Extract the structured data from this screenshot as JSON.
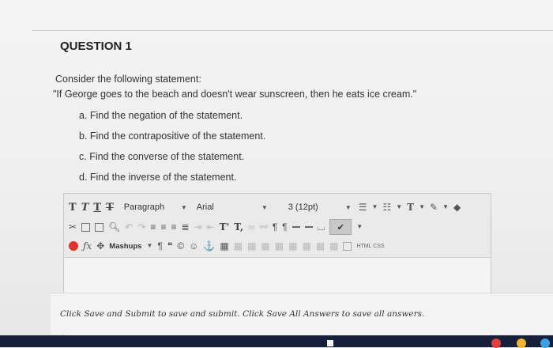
{
  "question": {
    "title": "QUESTION 1",
    "intro": "Consider the following statement:",
    "statement": "\"If George goes to the beach and doesn't wear sunscreen, then he eats ice cream.\"",
    "parts": [
      "a. Find the negation of the statement.",
      "b. Find the contrapositive of the statement.",
      "c. Find the converse of the statement.",
      "d. Find the inverse of the statement."
    ]
  },
  "toolbar": {
    "text_buttons": [
      "T",
      "T",
      "T",
      "T"
    ],
    "paragraph": "Paragraph",
    "font": "Arial",
    "size": "3 (12pt)",
    "mashups": "Mashups",
    "superscript": "T'",
    "subscript": "T,",
    "html_css": "HTML CSS",
    "icons": [
      "cut-icon",
      "copy-icon",
      "paste-icon",
      "find-icon",
      "undo-icon",
      "redo-icon",
      "align-left-icon",
      "align-center-icon",
      "align-right-icon",
      "justify-icon",
      "bullet-list-icon",
      "numbered-list-icon",
      "text-color-icon",
      "highlight-icon",
      "spellcheck-icon",
      "link-icon",
      "unlink-icon",
      "ltr-icon",
      "rtl-icon",
      "hr-icon",
      "nonbreaking-icon",
      "checkbox-icon",
      "formula-icon",
      "paragraph-mark-icon",
      "quote-icon",
      "copyright-icon",
      "emoji-icon",
      "anchor-icon",
      "table-icon"
    ]
  },
  "footer": {
    "text": "Click Save and Submit to save and submit. Click Save All Answers to save all answers."
  },
  "colors": {
    "red_icon": "#e0332b",
    "taskbar": "#16203a"
  }
}
